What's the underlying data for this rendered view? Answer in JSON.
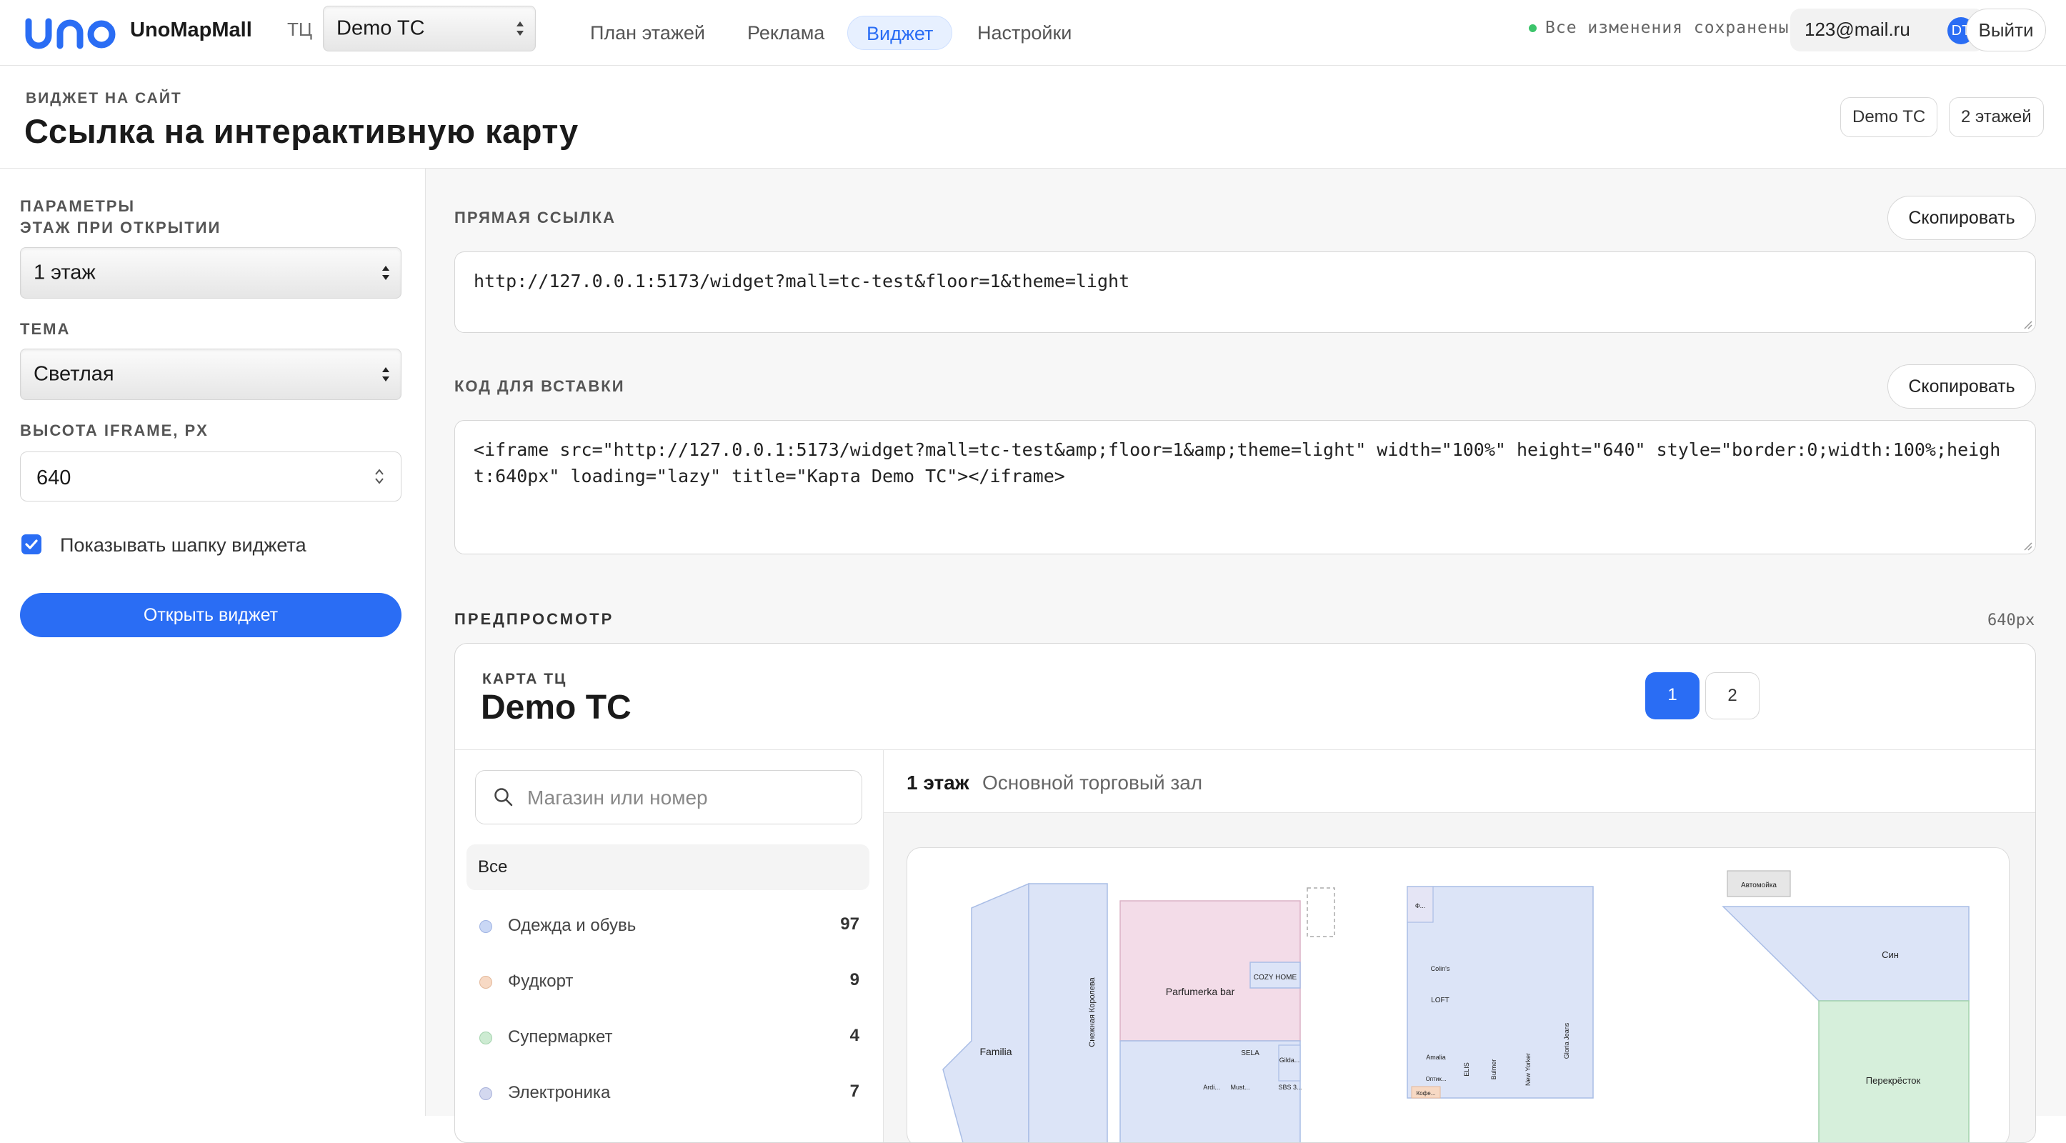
{
  "topbar": {
    "brand": "UnoMapMall",
    "tc_label": "ТЦ",
    "mall_select": "Demo TC",
    "nav": [
      {
        "label": "План этажей"
      },
      {
        "label": "Реклама"
      },
      {
        "label": "Виджет",
        "active": true
      },
      {
        "label": "Настройки"
      }
    ],
    "saved_status": "Все изменения сохранены",
    "user_email": "123@mail.ru",
    "user_initials": "DT",
    "logout_label": "Выйти"
  },
  "header": {
    "eyebrow": "ВИДЖЕТ НА САЙТ",
    "title": "Ссылка на интерактивную карту",
    "pill_mall": "Demo TC",
    "pill_floors": "2 этажей"
  },
  "sidebar": {
    "params_label": "ПАРАМЕТРЫ",
    "floor_label": "ЭТАЖ ПРИ ОТКРЫТИИ",
    "floor_value": "1 этаж",
    "theme_label": "ТЕМА",
    "theme_value": "Светлая",
    "height_label": "ВЫСОТА IFRAME, PX",
    "height_value": "640",
    "show_header_label": "Показывать шапку виджета",
    "show_header_checked": true,
    "open_widget_label": "Открыть виджет"
  },
  "main": {
    "direct_link_label": "ПРЯМАЯ ССЫЛКА",
    "copy_label": "Скопировать",
    "direct_link": "http://127.0.0.1:5173/widget?mall=tc-test&floor=1&theme=light",
    "embed_label": "КОД ДЛЯ ВСТАВКИ",
    "embed_code": "<iframe src=\"http://127.0.0.1:5173/widget?mall=tc-test&amp;floor=1&amp;theme=light\" width=\"100%\" height=\"640\" style=\"border:0;width:100%;height:640px\" loading=\"lazy\" title=\"Карта Demo TC\"></iframe>",
    "preview_label": "ПРЕДПРОСМОТР",
    "preview_size": "640px"
  },
  "widget": {
    "eyebrow": "КАРТА ТЦ",
    "title": "Demo TC",
    "floors": [
      "1",
      "2"
    ],
    "search_placeholder": "Магазин или номер",
    "all_label": "Все",
    "categories": [
      {
        "name": "Одежда и обувь",
        "count": "97",
        "color": "#c9d7f5"
      },
      {
        "name": "Фудкорт",
        "count": "9",
        "color": "#f7d9c4"
      },
      {
        "name": "Супермаркет",
        "count": "4",
        "color": "#cdebd2"
      },
      {
        "name": "Электроника",
        "count": "7",
        "color": "#d3d8ef"
      }
    ],
    "floor_name": "1 этаж",
    "floor_desc": "Основной торговый зал",
    "map_labels": {
      "familia": "Familia",
      "snow": "Снежная Королева",
      "parfumerka": "Parfumerka bar",
      "cozy": "COZY HOME",
      "sela": "SELA",
      "gilda": "Gilda...",
      "ardi": "Ardi...",
      "must": "Must...",
      "sbs": "SBS 3...",
      "colins": "Colin's",
      "loft": "LOFT",
      "amalia": "Amalia",
      "optim": "Оптик...",
      "cafe": "Кофе...",
      "elis": "ELIS",
      "bulmer": "Bulmer",
      "newyorker": "New Yorker",
      "gloria": "Gloria Jeans",
      "carwash": "Автомойка",
      "sin": "Син",
      "perekrestok": "Перекрёсток",
      "small": "Ф..."
    }
  }
}
